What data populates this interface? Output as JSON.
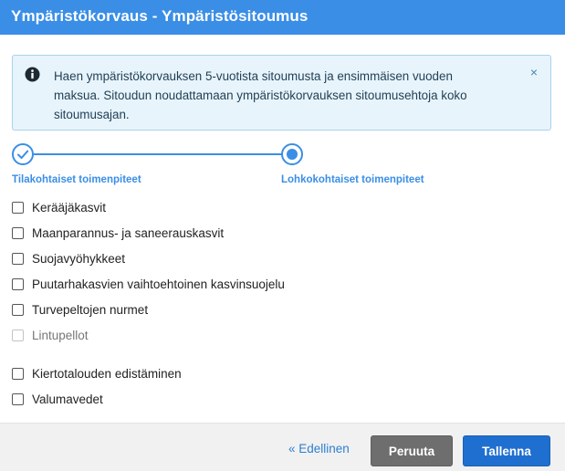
{
  "dialog": {
    "title": "Ympäristökorvaus - Ympäristösitoumus"
  },
  "info": {
    "text": "Haen ympäristökorvauksen 5-vuotista sitoumusta ja ensimmäisen vuoden maksua. Sitoudun noudattamaan ympäristökorvauksen sitoumusehtoja koko sitoumusajan.",
    "icon": "info-icon",
    "close_symbol": "×"
  },
  "stepper": {
    "steps": [
      {
        "label": "Tilakohtaiset toimenpiteet",
        "state": "completed"
      },
      {
        "label": "Lohkokohtaiset toimenpiteet",
        "state": "current"
      }
    ]
  },
  "options": [
    {
      "label": "Kerääjäkasvit",
      "checked": false,
      "disabled": false
    },
    {
      "label": "Maanparannus- ja saneerauskasvit",
      "checked": false,
      "disabled": false
    },
    {
      "label": "Suojavyöhykkeet",
      "checked": false,
      "disabled": false
    },
    {
      "label": "Puutarhakasvien vaihtoehtoinen kasvinsuojelu",
      "checked": false,
      "disabled": false
    },
    {
      "label": "Turvepeltojen nurmet",
      "checked": false,
      "disabled": false
    },
    {
      "label": "Lintupellot",
      "checked": false,
      "disabled": true
    },
    {
      "label": "Kiertotalouden edistäminen",
      "checked": false,
      "disabled": false
    },
    {
      "label": "Valumavedet",
      "checked": false,
      "disabled": false
    }
  ],
  "footer": {
    "back_label": "« Edellinen",
    "cancel_label": "Peruuta",
    "save_label": "Tallenna"
  },
  "colors": {
    "header": "#3a8ee6",
    "info_bg": "#e8f4fb",
    "cancel": "#6e6e6e",
    "save": "#1f6fd0"
  }
}
